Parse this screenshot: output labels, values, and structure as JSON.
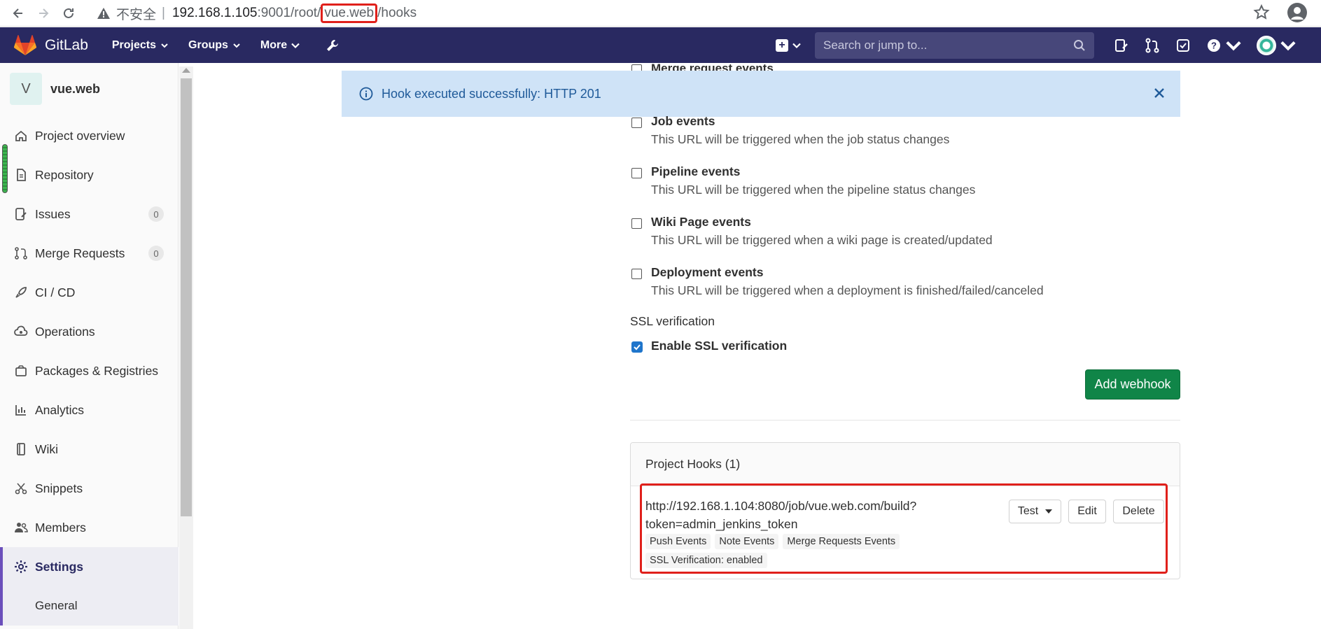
{
  "browser": {
    "insecure_label": "不安全",
    "separator": "|",
    "url_host": "192.168.1.105",
    "url_pre": ":9001/root/",
    "url_highlight": "vue.web",
    "url_post": "/hooks"
  },
  "navbar": {
    "brand": "GitLab",
    "menu": [
      "Projects",
      "Groups",
      "More"
    ],
    "search_placeholder": "Search or jump to..."
  },
  "sidebar": {
    "project_initial": "V",
    "project_name": "vue.web",
    "items": [
      {
        "label": "Project overview"
      },
      {
        "label": "Repository"
      },
      {
        "label": "Issues",
        "count": "0"
      },
      {
        "label": "Merge Requests",
        "count": "0"
      },
      {
        "label": "CI / CD"
      },
      {
        "label": "Operations"
      },
      {
        "label": "Packages & Registries"
      },
      {
        "label": "Analytics"
      },
      {
        "label": "Wiki"
      },
      {
        "label": "Snippets"
      },
      {
        "label": "Members"
      },
      {
        "label": "Settings"
      }
    ],
    "sub_item": "General"
  },
  "flash": {
    "message": "Hook executed successfully: HTTP 201"
  },
  "events": {
    "partial_top": "Merge request events",
    "list": [
      {
        "title": "Job events",
        "desc": "This URL will be triggered when the job status changes"
      },
      {
        "title": "Pipeline events",
        "desc": "This URL will be triggered when the pipeline status changes"
      },
      {
        "title": "Wiki Page events",
        "desc": "This URL will be triggered when a wiki page is created/updated"
      },
      {
        "title": "Deployment events",
        "desc": "This URL will be triggered when a deployment is finished/failed/canceled"
      }
    ]
  },
  "ssl": {
    "title": "SSL verification",
    "label": "Enable SSL verification",
    "checked": true
  },
  "add_webhook_label": "Add webhook",
  "hooks": {
    "header": "Project Hooks (1)",
    "url_line1": "http://192.168.1.104:8080/job/vue.web.com/build?",
    "url_line2": "token=admin_jenkins_token",
    "tags": [
      "Push Events",
      "Note Events",
      "Merge Requests Events"
    ],
    "ssl_status": "SSL Verification: enabled",
    "buttons": {
      "test": "Test",
      "edit": "Edit",
      "delete": "Delete"
    }
  },
  "colors": {
    "navbar": "#292961",
    "flash_bg": "#cfe3f7",
    "add_button": "#108548",
    "highlight_box": "#e0201b",
    "checkbox_checked": "#1f75cb"
  }
}
